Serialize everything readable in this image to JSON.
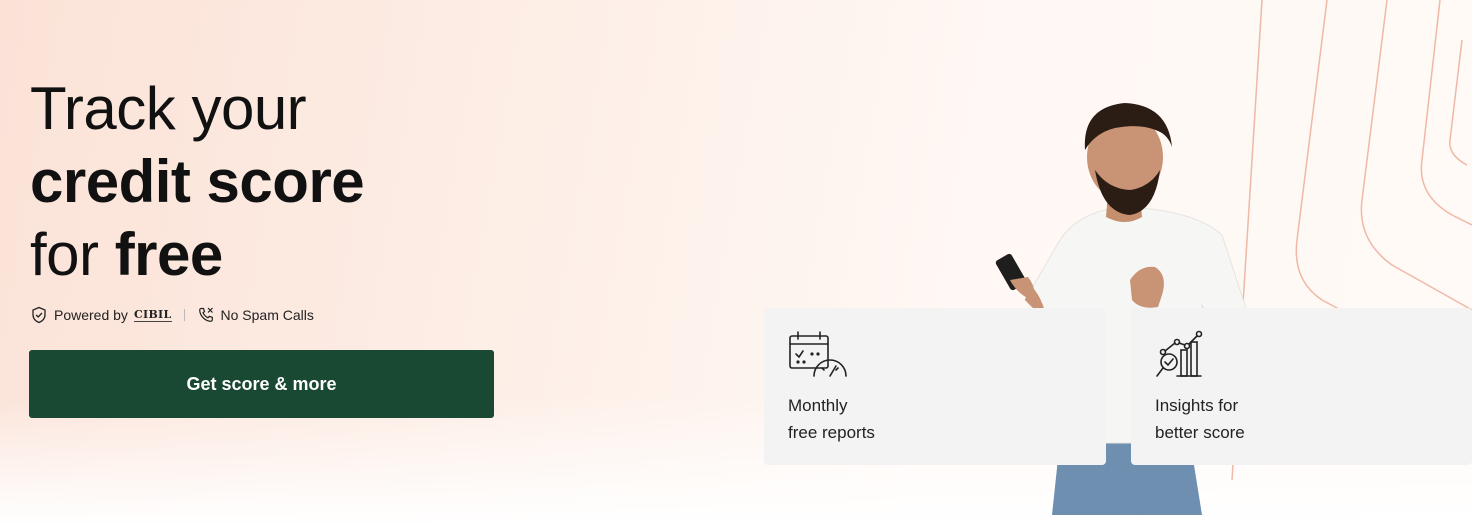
{
  "hero": {
    "headline_line1": "Track your",
    "headline_line2": "credit score",
    "headline_line3_thin": "for",
    "headline_line3_bold": "free"
  },
  "trust": {
    "powered_by": "Powered by",
    "partner": "CIBIL",
    "no_spam": "No Spam Calls"
  },
  "cta": {
    "label": "Get score & more"
  },
  "features": [
    {
      "line1": "Monthly",
      "line2": "free reports",
      "icon": "calendar-gauge-icon"
    },
    {
      "line1": "Insights for",
      "line2": "better score",
      "icon": "chart-magnifier-icon"
    }
  ],
  "colors": {
    "cta_bg": "#194833",
    "accent_line": "#f0b8a6",
    "card_bg": "#f3f3f3"
  }
}
